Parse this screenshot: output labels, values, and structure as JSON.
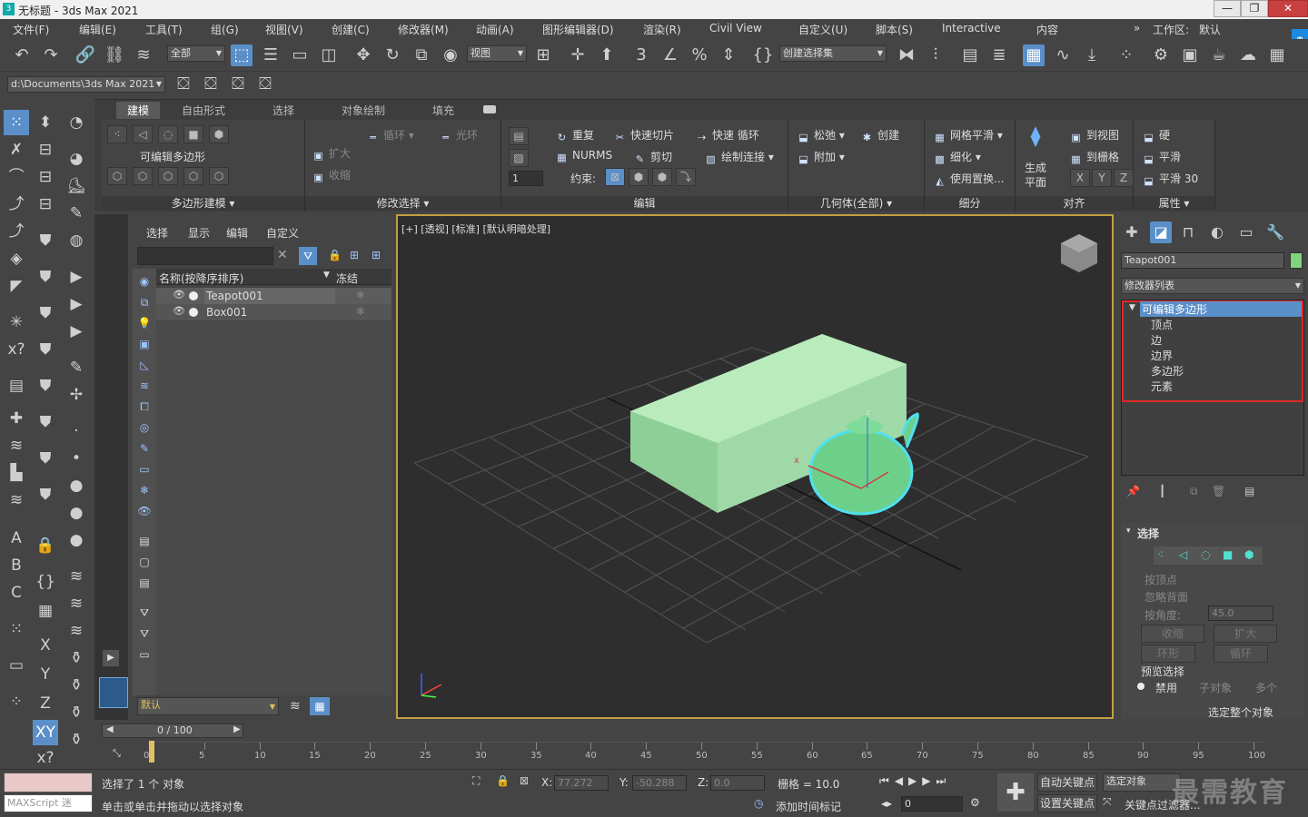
{
  "window": {
    "title": "无标题 - 3ds Max 2021"
  },
  "menu": [
    "文件(F)",
    "编辑(E)",
    "工具(T)",
    "组(G)",
    "视图(V)",
    "创建(C)",
    "修改器(M)",
    "动画(A)",
    "图形编辑器(D)",
    "渲染(R)",
    "Civil View",
    "自定义(U)",
    "脚本(S)",
    "Interactive",
    "内容"
  ],
  "workspace": {
    "label": "工作区:",
    "value": "默认"
  },
  "toolbar": {
    "filter_value": "全部",
    "ref_coord": "视图",
    "selection_set": "创建选择集",
    "path": "d:\\Documents\\3ds Max 2021"
  },
  "ribbon": {
    "tabs": [
      "建模",
      "自由形式",
      "选择",
      "对象绘制",
      "填充"
    ],
    "poly_label": "可编辑多边形",
    "sections": {
      "poly_modeling": "多边形建模",
      "modify_selection": "修改选择",
      "edit": "编辑",
      "geometry": "几何体(全部)",
      "subdivision": "细分",
      "align": "对齐",
      "properties": "属性"
    },
    "modsel": {
      "grow": "扩大",
      "shrink": "收缩",
      "loop": "循环",
      "ring": "光环"
    },
    "edit": {
      "repeat": "重复",
      "quickslice": "快速切片",
      "quickloop": "快速 循环",
      "nurms": "NURMS",
      "cut": "剪切",
      "paintconnect": "绘制连接",
      "constraint": "约束:"
    },
    "geometry": {
      "relax": "松弛",
      "create": "创建",
      "attach": "附加"
    },
    "subdiv": {
      "meshsmooth": "网格平滑",
      "tessellate": "细化",
      "useplace": "使用置换..."
    },
    "align": {
      "genplane": "生成",
      "plane": "平面",
      "toview": "到视图",
      "togrid": "到栅格",
      "x": "X",
      "y": "Y",
      "z": "Z"
    },
    "props": {
      "hard": "硬",
      "smooth": "平滑",
      "smooth30": "平滑 30"
    }
  },
  "scene_explorer": {
    "tabs": [
      "选择",
      "显示",
      "编辑",
      "自定义"
    ],
    "col_name": "名称(按降序排序)",
    "col_freeze": "冻结",
    "rows": [
      "Teapot001",
      "Box001"
    ],
    "layer": "默认"
  },
  "viewport": {
    "label": "[+] [透视] [标准] [默认明暗处理]",
    "gizmo_z": "z",
    "gizmo_x": "x"
  },
  "command_panel": {
    "object_name": "Teapot001",
    "modifier_list": "修改器列表",
    "stack": [
      "可编辑多边形",
      "顶点",
      "边",
      "边界",
      "多边形",
      "元素"
    ],
    "selection_title": "选择",
    "by_vertex": "按顶点",
    "ignore_backface": "忽略背面",
    "by_angle": "按角度:",
    "angle_value": "45.0",
    "shrink": "收缩",
    "grow": "扩大",
    "ring": "环形",
    "loop": "循环",
    "preview": "预览选择",
    "disabled": "禁用",
    "subobject": "子对象",
    "multi": "多个",
    "select_whole": "选定整个对象"
  },
  "timeline": {
    "frame": "0 / 100",
    "ticks": [
      "0",
      "5",
      "10",
      "15",
      "20",
      "25",
      "30",
      "35",
      "40",
      "45",
      "50",
      "55",
      "60",
      "65",
      "70",
      "75",
      "80",
      "85",
      "90",
      "95",
      "100"
    ]
  },
  "status": {
    "maxscript": "MAXScript 迷",
    "selected": "选择了 1 个 对象",
    "hint": "单击或单击并拖动以选择对象",
    "x_label": "X:",
    "x": "77.272",
    "y_label": "Y:",
    "y": "-50.288",
    "z_label": "Z:",
    "z": "0.0",
    "grid": "栅格 = 10.0",
    "add_tag": "添加时间标记",
    "autokey": "自动关键点",
    "selected_obj": "选定对象",
    "setkey": "设置关键点",
    "keyfilter": "关键点过滤器...",
    "frame_field": "0",
    "watermark": "最需教育"
  }
}
